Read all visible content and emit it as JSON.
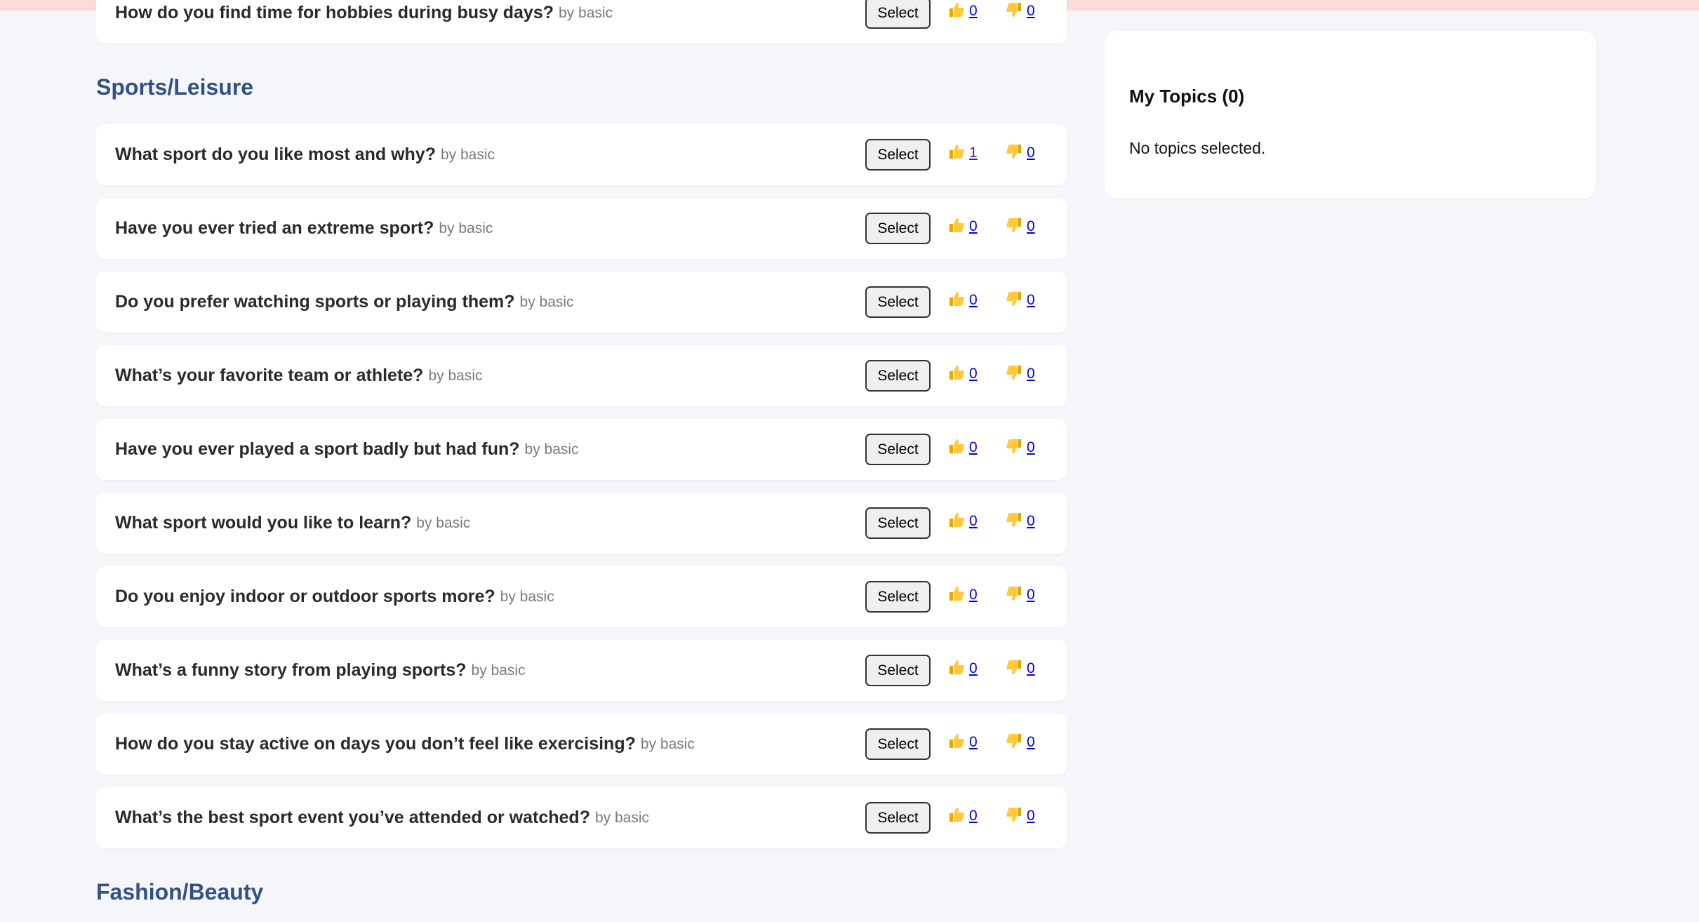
{
  "partial_topic": {
    "title": "How do you find time for hobbies during busy days?",
    "author": "by basic",
    "select_label": "Select",
    "up": "0",
    "down": "0"
  },
  "sections": [
    {
      "heading": "Sports/Leisure"
    },
    {
      "heading": "Fashion/Beauty"
    }
  ],
  "topics": [
    {
      "title": "What sport do you like most and why?",
      "author": "by basic",
      "select_label": "Select",
      "up": "1",
      "down": "0"
    },
    {
      "title": "Have you ever tried an extreme sport?",
      "author": "by basic",
      "select_label": "Select",
      "up": "0",
      "down": "0"
    },
    {
      "title": "Do you prefer watching sports or playing them?",
      "author": "by basic",
      "select_label": "Select",
      "up": "0",
      "down": "0"
    },
    {
      "title": "What’s your favorite team or athlete?",
      "author": "by basic",
      "select_label": "Select",
      "up": "0",
      "down": "0"
    },
    {
      "title": "Have you ever played a sport badly but had fun?",
      "author": "by basic",
      "select_label": "Select",
      "up": "0",
      "down": "0"
    },
    {
      "title": "What sport would you like to learn?",
      "author": "by basic",
      "select_label": "Select",
      "up": "0",
      "down": "0"
    },
    {
      "title": "Do you enjoy indoor or outdoor sports more?",
      "author": "by basic",
      "select_label": "Select",
      "up": "0",
      "down": "0"
    },
    {
      "title": "What’s a funny story from playing sports?",
      "author": "by basic",
      "select_label": "Select",
      "up": "0",
      "down": "0"
    },
    {
      "title": "How do you stay active on days you don’t feel like exercising?",
      "author": "by basic",
      "select_label": "Select",
      "up": "0",
      "down": "0"
    },
    {
      "title": "What’s the best sport event you’ve attended or watched?",
      "author": "by basic",
      "select_label": "Select",
      "up": "0",
      "down": "0"
    }
  ],
  "sidebar": {
    "title": "My Topics (0)",
    "empty_text": "No topics selected."
  },
  "icons": {
    "upvote": "thumbs-up-icon",
    "downvote": "thumbs-down-icon"
  },
  "colors": {
    "heading": "#345184",
    "link": "#0000ee",
    "visited_link": "#551a8b",
    "background": "#f4f6fa",
    "top_banner": "#fbdcd6"
  }
}
